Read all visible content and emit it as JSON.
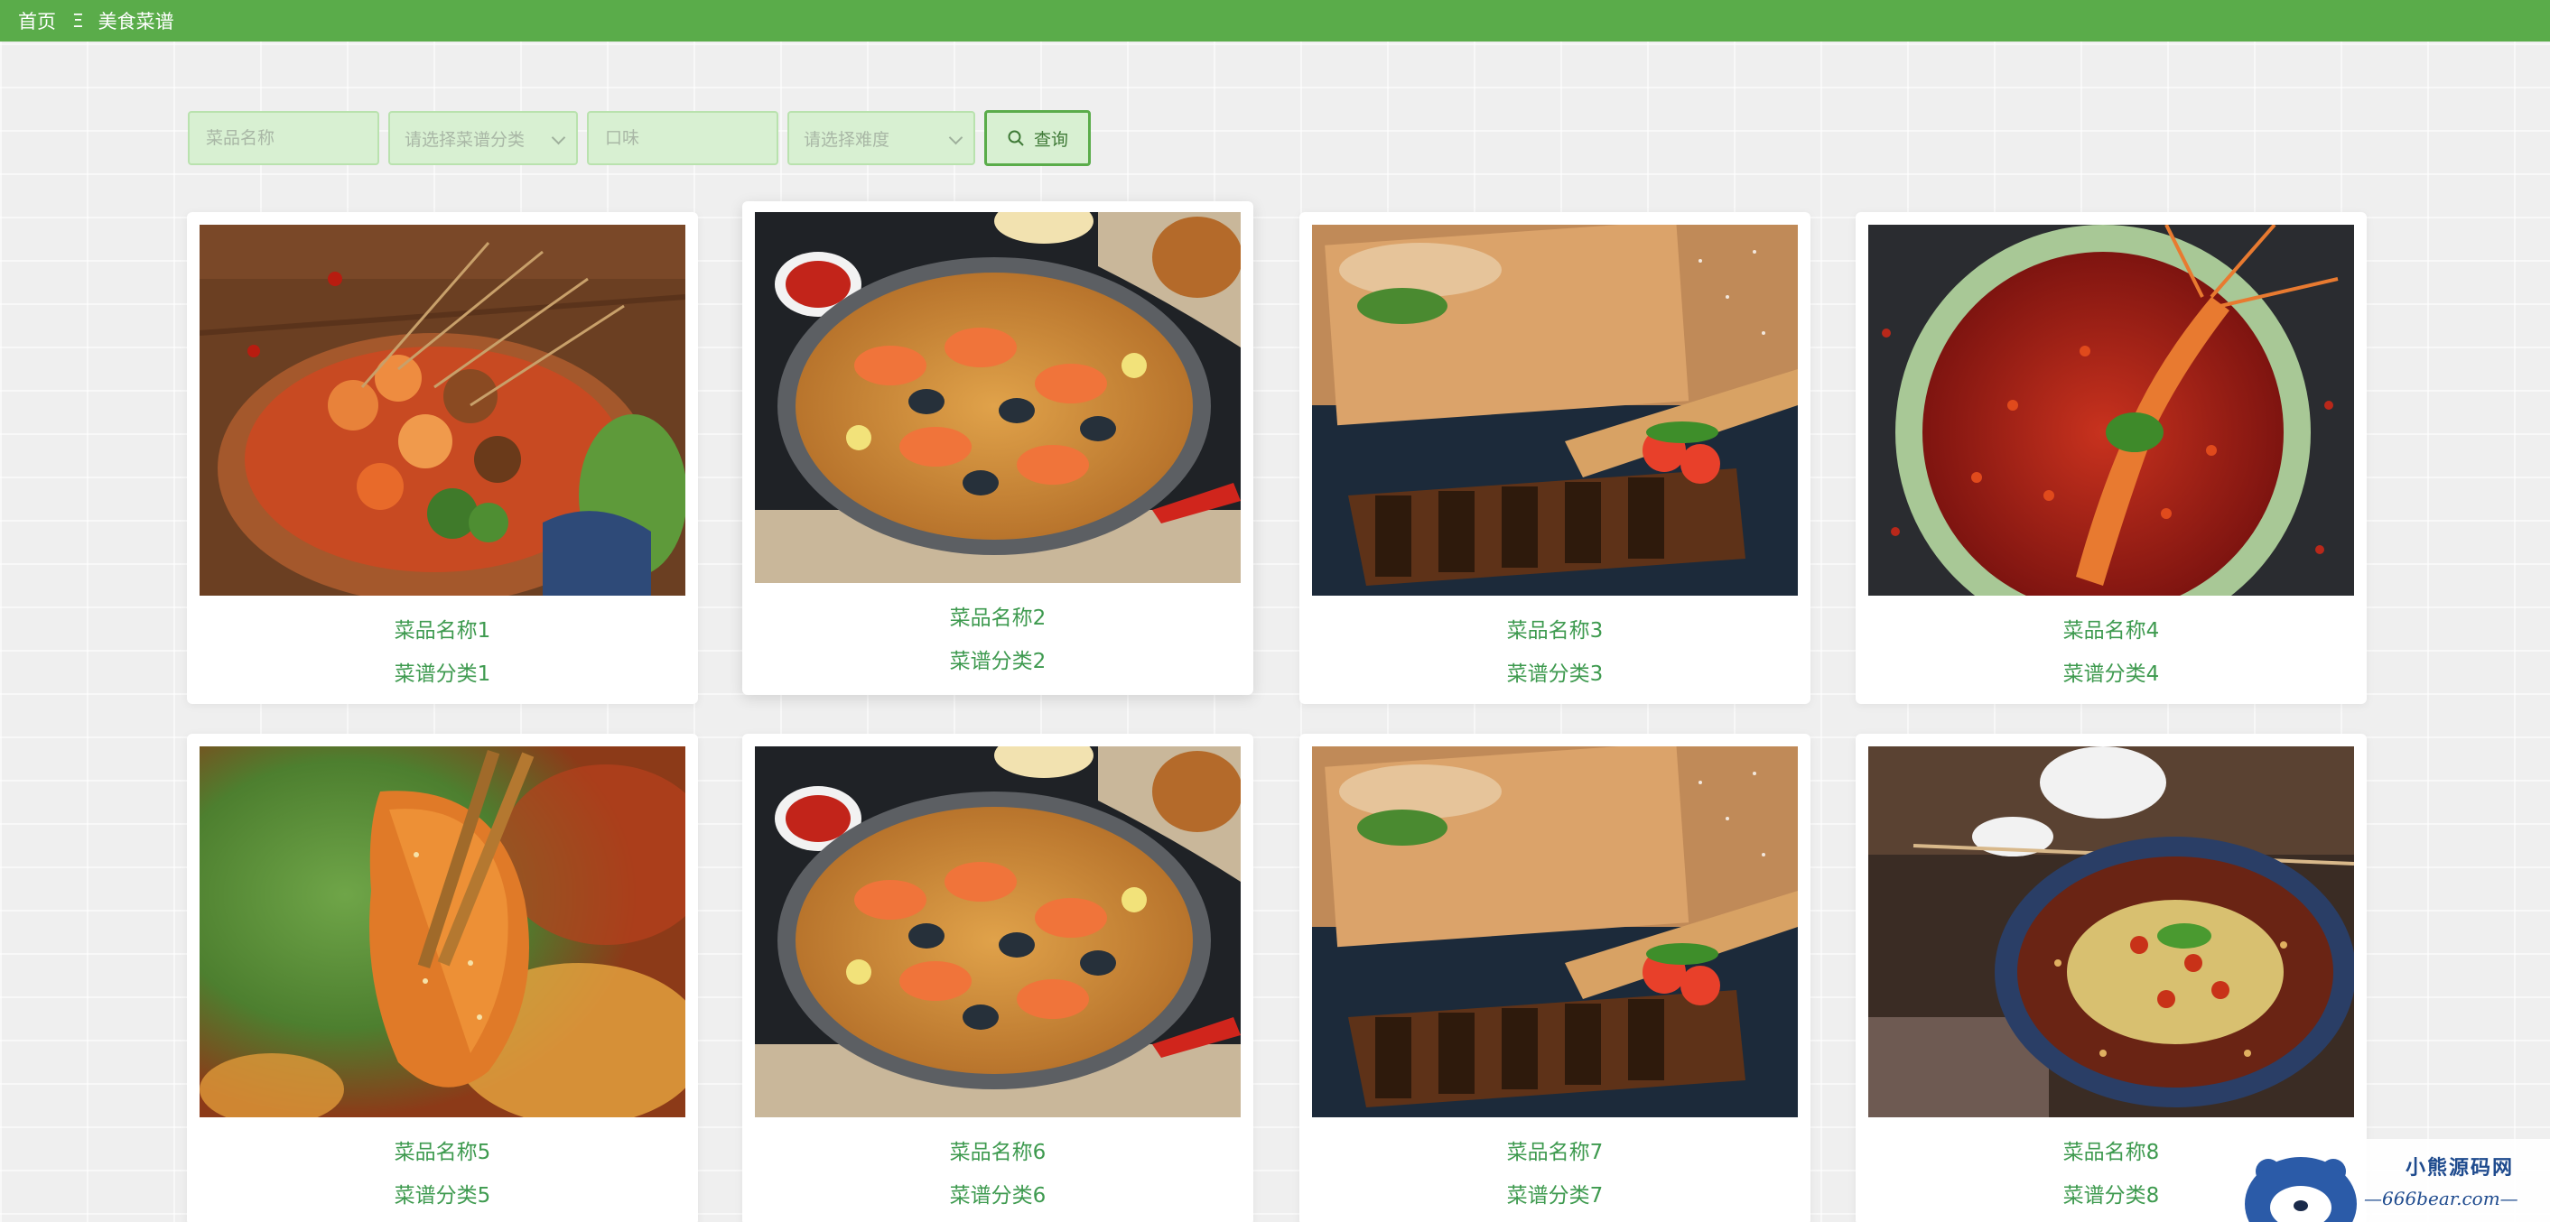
{
  "nav": {
    "home_label": "首页",
    "separator": "Ξ",
    "current_label": "美食菜谱",
    "bar_color": "#5aac4a"
  },
  "filters": {
    "name_placeholder": "菜品名称",
    "category_placeholder": "请选择菜谱分类",
    "taste_placeholder": "口味",
    "difficulty_placeholder": "请选择难度",
    "search_label": "查询",
    "search_icon": "search-icon"
  },
  "recipes": [
    {
      "name": "菜品名称1",
      "category": "菜谱分类1",
      "photo": "skewers-hotpot"
    },
    {
      "name": "菜品名称2",
      "category": "菜谱分类2",
      "photo": "seafood-paella"
    },
    {
      "name": "菜品名称3",
      "category": "菜谱分类3",
      "photo": "grilled-eel"
    },
    {
      "name": "菜品名称4",
      "category": "菜谱分类4",
      "photo": "spicy-lobster"
    },
    {
      "name": "菜品名称5",
      "category": "菜谱分类5",
      "photo": "chopsticks-shrimp"
    },
    {
      "name": "菜品名称6",
      "category": "菜谱分类6",
      "photo": "seafood-paella"
    },
    {
      "name": "菜品名称7",
      "category": "菜谱分类7",
      "photo": "grilled-eel"
    },
    {
      "name": "菜品名称8",
      "category": "菜谱分类8",
      "photo": "chili-oil-dish"
    }
  ],
  "watermark": {
    "title": "小熊源码网",
    "url": "—666bear.com—"
  },
  "colors": {
    "accent": "#5aac4a",
    "text_green": "#3e9a4f",
    "field_bg": "#d8f0d2"
  }
}
